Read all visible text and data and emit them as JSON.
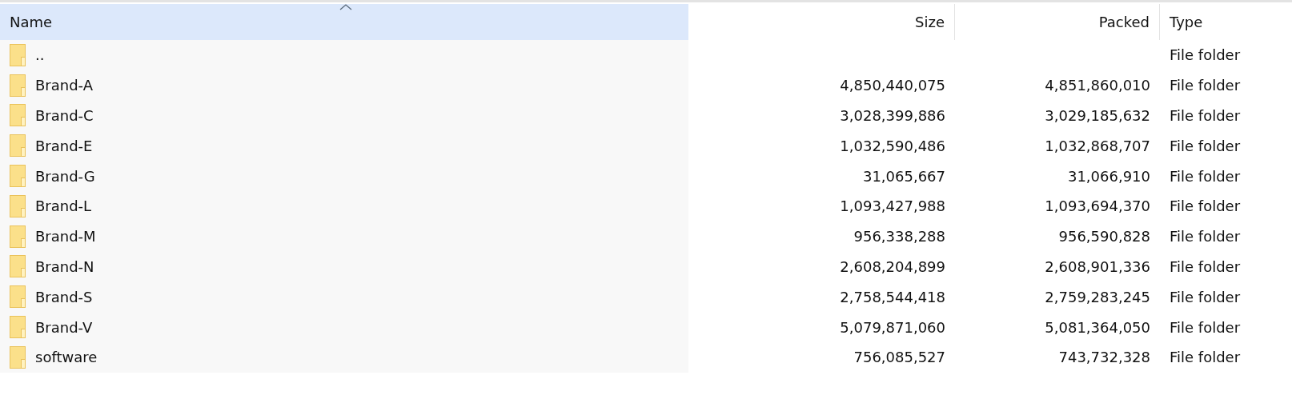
{
  "columns": [
    {
      "label": "Name",
      "sorted": true,
      "kind": "text"
    },
    {
      "label": "Size",
      "sorted": false,
      "kind": "number"
    },
    {
      "label": "Packed",
      "sorted": false,
      "kind": "number"
    },
    {
      "label": "Type",
      "sorted": false,
      "kind": "text"
    }
  ],
  "rows": [
    {
      "name": "..",
      "type": "File folder"
    },
    {
      "name": "Brand-A",
      "size": "4,850,440,075",
      "packed": "4,851,860,010",
      "type": "File folder"
    },
    {
      "name": "Brand-C",
      "size": "3,028,399,886",
      "packed": "3,029,185,632",
      "type": "File folder"
    },
    {
      "name": "Brand-E",
      "size": "1,032,590,486",
      "packed": "1,032,868,707",
      "type": "File folder"
    },
    {
      "name": "Brand-G",
      "size": "31,065,667",
      "packed": "31,066,910",
      "type": "File folder"
    },
    {
      "name": "Brand-L",
      "size": "1,093,427,988",
      "packed": "1,093,694,370",
      "type": "File folder"
    },
    {
      "name": "Brand-M",
      "size": "956,338,288",
      "packed": "956,590,828",
      "type": "File folder"
    },
    {
      "name": "Brand-N",
      "size": "2,608,204,899",
      "packed": "2,608,901,336",
      "type": "File folder"
    },
    {
      "name": "Brand-S",
      "size": "2,758,544,418",
      "packed": "2,759,283,245",
      "type": "File folder"
    },
    {
      "name": "Brand-V",
      "size": "5,079,871,060",
      "packed": "5,081,364,050",
      "type": "File folder"
    },
    {
      "name": "software",
      "size": "756,085,527",
      "packed": "743,732,328",
      "type": "File folder"
    }
  ]
}
